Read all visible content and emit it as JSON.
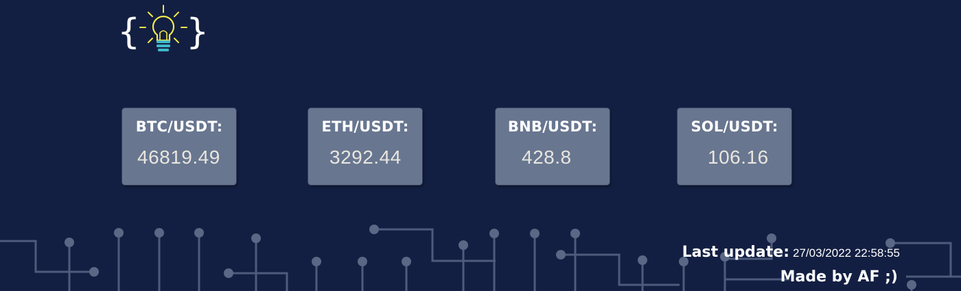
{
  "logo": {
    "icon": "lightbulb-braces-icon",
    "colors": {
      "braces": "#ffffff",
      "bulb": "#f5e94a",
      "base": "#3fb8c9"
    }
  },
  "tickers": [
    {
      "pair": "BTC/USDT:",
      "price": "46819.49"
    },
    {
      "pair": "ETH/USDT:",
      "price": "3292.44"
    },
    {
      "pair": "BNB/USDT:",
      "price": "428.8"
    },
    {
      "pair": "SOL/USDT:",
      "price": "106.16"
    }
  ],
  "footer": {
    "last_update_label": "Last update:",
    "last_update_value": "27/03/2022 22:58:55",
    "credit": "Made by AF ;)"
  },
  "colors": {
    "background": "#131f42",
    "card": "#687690",
    "circuit": "#5a6785"
  }
}
